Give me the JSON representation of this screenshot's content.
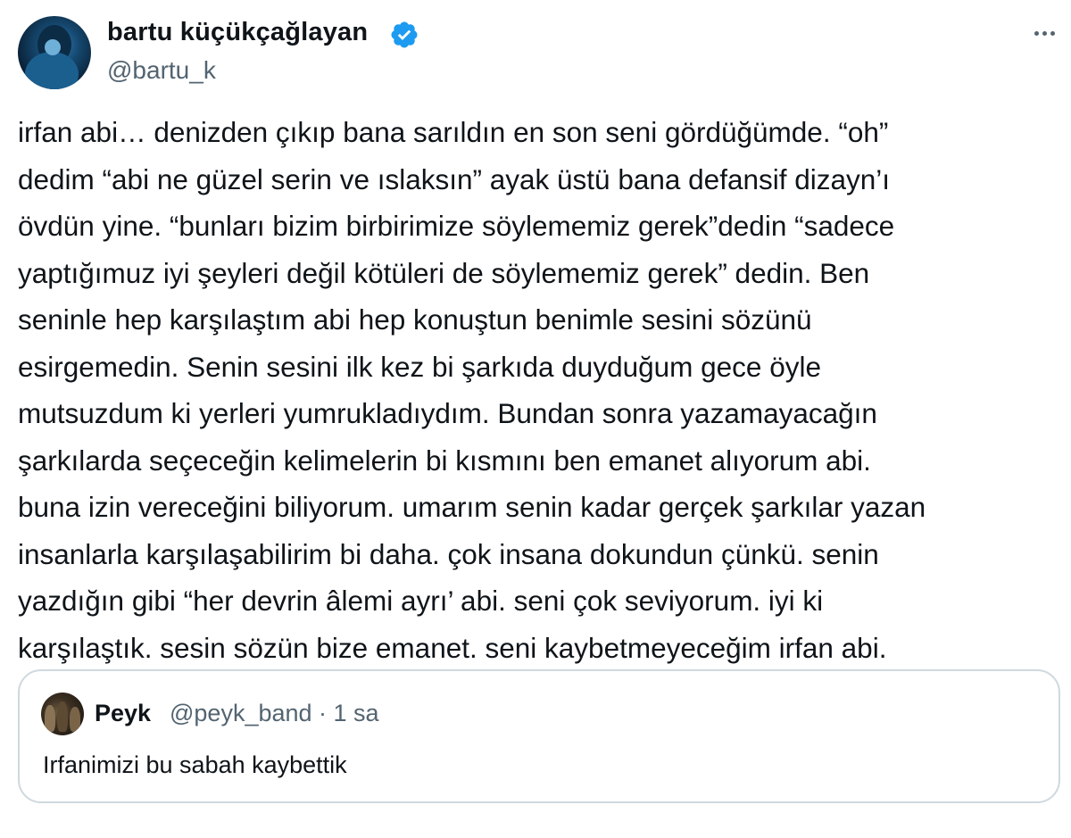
{
  "tweet": {
    "author": {
      "name": "bartu küçükçağlayan",
      "handle": "@bartu_k",
      "verified": true
    },
    "text": "irfan abi… denizden çıkıp bana sarıldın en son seni gördüğümde. “oh”\ndedim “abi ne güzel serin ve ıslaksın”  ayak üstü bana defansif dizayn’ı\növdün yine. “bunları bizim birbirimize söylememiz gerek”dedin “sadece\nyaptığımuz  iyi şeyleri değil kötüleri de söylememiz gerek” dedin. Ben\nseninle hep karşılaştım abi hep konuştun benimle sesini sözünü\nesirgemedin. Senin sesini ilk kez bi şarkıda duyduğum gece öyle\nmutsuzdum ki yerleri yumrukladıydım. Bundan sonra yazamayacağın\nşarkılarda seçeceğin kelimelerin bi kısmını  ben emanet alıyorum abi.\nbuna izin vereceğini biliyorum. umarım senin kadar gerçek şarkılar yazan\ninsanlarla karşılaşabilirim bi daha. çok insana dokundun çünkü. senin\nyazdığın gibi  “her devrin âlemi ayrı’ abi. seni çok seviyorum.  iyi ki\nkarşılaştık. sesin sözün bize emanet. seni kaybetmeyeceğim irfan abi.",
    "quoted": {
      "name": "Peyk",
      "meta": "@peyk_band · 1 sa",
      "text": "Irfanimizi bu sabah kaybettik"
    }
  },
  "icons": {
    "verified": "verified-badge-icon",
    "more": "more-options-icon"
  },
  "colors": {
    "text": "#0f1419",
    "secondary": "#536471",
    "verified": "#1d9bf0",
    "border": "#cfd9de"
  }
}
